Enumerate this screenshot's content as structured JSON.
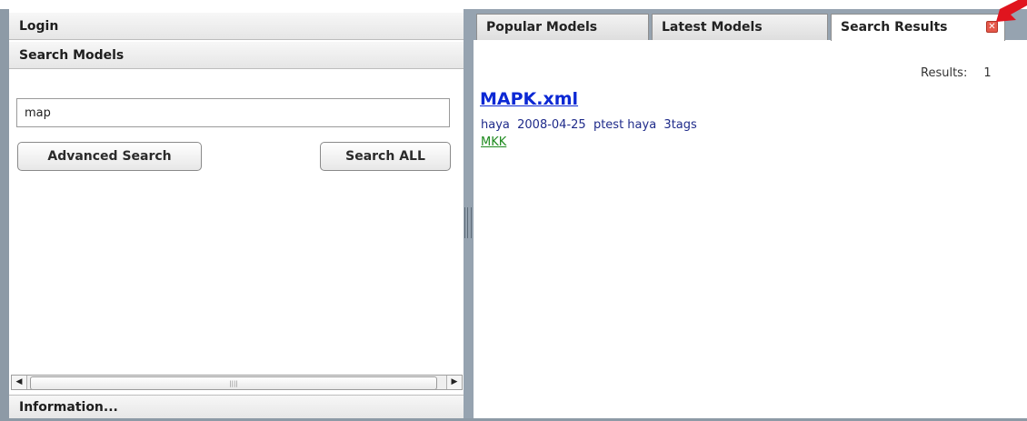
{
  "left_panel": {
    "login_header": "Login",
    "search_header": "Search Models",
    "search_input_value": "map",
    "advanced_search_label": "Advanced Search",
    "search_all_label": "Search ALL",
    "information_header": "Information..."
  },
  "tabs": [
    {
      "label": "Popular Models",
      "active": false
    },
    {
      "label": "Latest Models",
      "active": false
    },
    {
      "label": "Search Results",
      "active": true
    }
  ],
  "results": {
    "count_label": "Results:",
    "count": "1",
    "items": [
      {
        "title": "MAPK.xml",
        "meta": "haya  2008-04-25  ptest haya  3tags",
        "tag": "MKK"
      }
    ]
  },
  "colors": {
    "frame": "#96a3b0",
    "link_title": "#0c28d4",
    "meta_text": "#1f2b8a",
    "tag_link": "#1f8a1f",
    "close_icon": "#e5584a",
    "annotation_arrow": "#e0141e"
  },
  "icons": {
    "close": "close-icon",
    "scroll_left": "scroll-left-arrow-icon",
    "scroll_right": "scroll-right-arrow-icon",
    "annotation": "red-pointer-arrow-icon"
  }
}
